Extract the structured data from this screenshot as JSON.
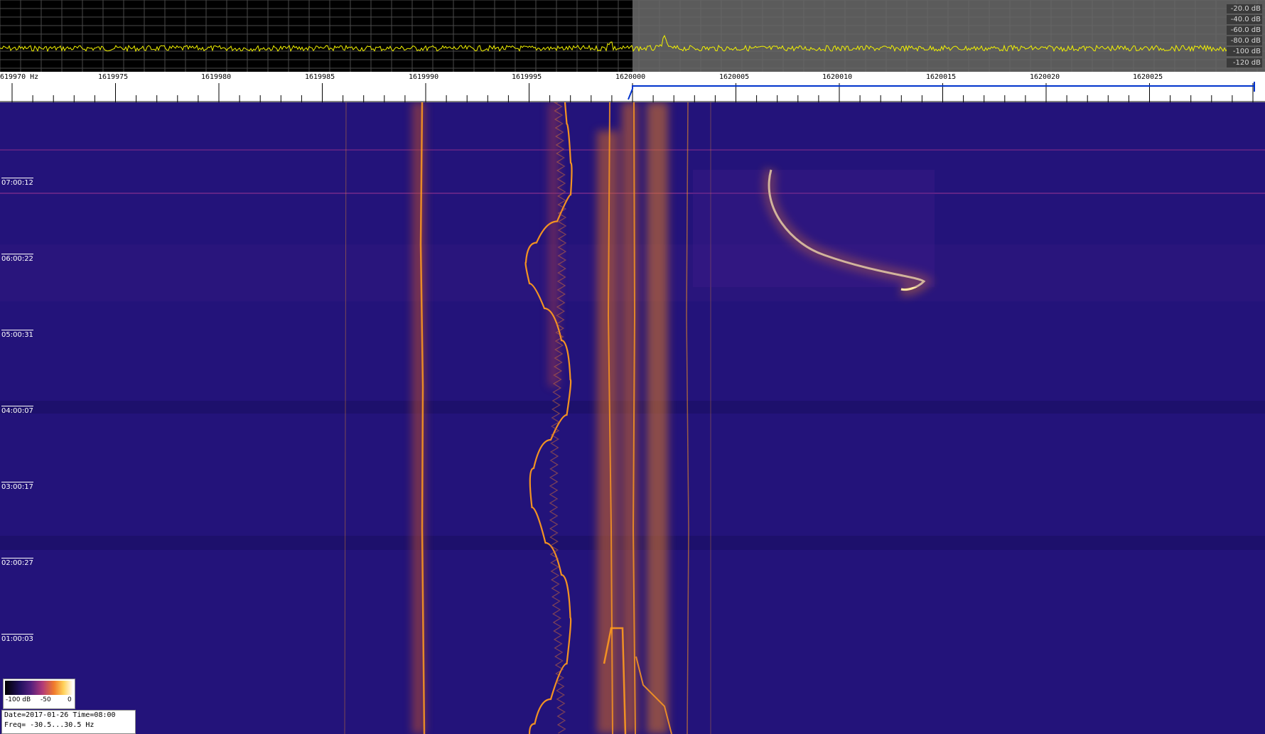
{
  "spectrum": {
    "db_labels": [
      "-20.0 dB",
      "-40.0 dB",
      "-60.0 dB",
      "-80.0 dB",
      "-100 dB",
      "-120 dB"
    ],
    "trace_color": "#f2f200"
  },
  "scale": {
    "freq_labels": [
      "619970 Hz",
      "1619975",
      "1619980",
      "1619985",
      "1619990",
      "1619995",
      "1620000",
      "1620005",
      "1620010",
      "1620015",
      "1620020",
      "1620025"
    ],
    "marker_color": "#0033cc"
  },
  "waterfall": {
    "time_labels": [
      "07:00:12",
      "06:00:22",
      "05:00:31",
      "04:00:07",
      "03:00:17",
      "02:00:27",
      "01:00:03"
    ],
    "background_color": "#23137a",
    "signal_color": "#ff9a1e"
  },
  "legend": {
    "ticks": [
      "-100 dB",
      "-50",
      "0"
    ]
  },
  "info": {
    "line1": "Date=2017-01-26 Time=08:00",
    "line2": "Freq= -30.5...30.5 Hz"
  }
}
